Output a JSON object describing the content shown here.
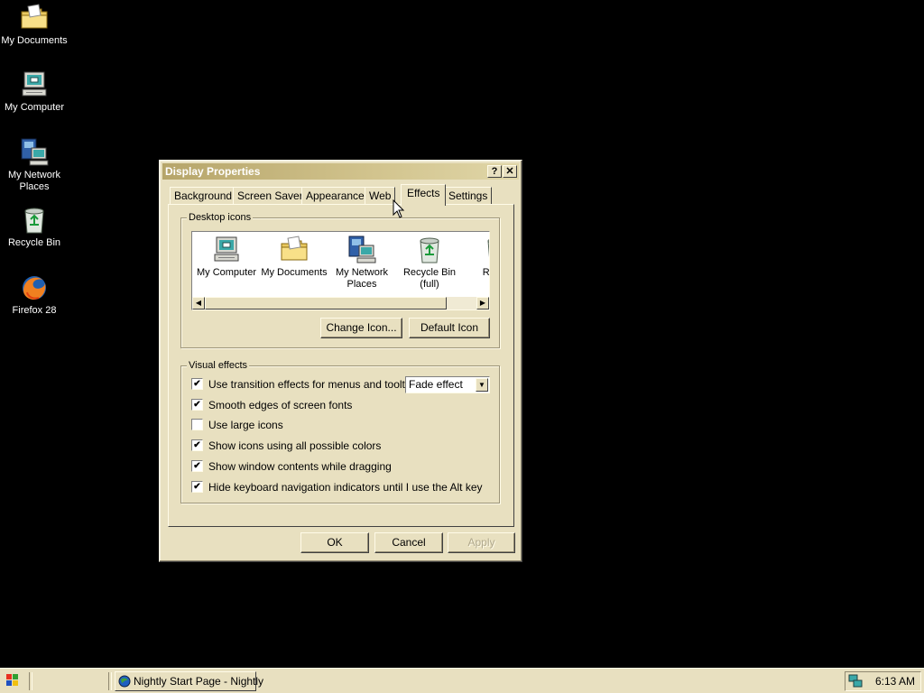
{
  "desktop": {
    "icons": [
      {
        "label": "My Documents",
        "icon": "folder-icon"
      },
      {
        "label": "My Computer",
        "icon": "computer-icon"
      },
      {
        "label": "My Network Places",
        "icon": "network-icon"
      },
      {
        "label": "Recycle Bin",
        "icon": "recycle-bin-icon"
      },
      {
        "label": "Firefox 28",
        "icon": "firefox-icon"
      }
    ]
  },
  "window": {
    "title": "Display Properties",
    "help_label": "?",
    "close_label": "✕",
    "tabs": [
      {
        "label": "Background",
        "active": false
      },
      {
        "label": "Screen Saver",
        "active": false
      },
      {
        "label": "Appearance",
        "active": false
      },
      {
        "label": "Web",
        "active": false
      },
      {
        "label": "Effects",
        "active": true
      },
      {
        "label": "Settings",
        "active": false
      }
    ],
    "desktop_icons": {
      "title": "Desktop icons",
      "items": [
        {
          "label": "My Computer",
          "icon": "computer-icon"
        },
        {
          "label": "My Documents",
          "icon": "folder-icon"
        },
        {
          "label": "My Network Places",
          "icon": "network-icon"
        },
        {
          "label": "Recycle Bin (full)",
          "icon": "recycle-bin-full-icon"
        },
        {
          "label": "Rec (e",
          "icon": "recycle-bin-empty-icon"
        }
      ],
      "change_icon_label": "Change Icon...",
      "default_icon_label": "Default Icon"
    },
    "visual_effects": {
      "title": "Visual effects",
      "options": [
        {
          "label": "Use transition effects for menus and tooltips",
          "checked": true
        },
        {
          "label": "Smooth edges of screen fonts",
          "checked": true
        },
        {
          "label": "Use large icons",
          "checked": false
        },
        {
          "label": "Show icons using all possible colors",
          "checked": true
        },
        {
          "label": "Show window contents while dragging",
          "checked": true
        },
        {
          "label": "Hide keyboard navigation indicators until I use the Alt key",
          "checked": true
        }
      ],
      "transition_select": "Fade effect"
    },
    "buttons": {
      "ok": "OK",
      "cancel": "Cancel",
      "apply": "Apply"
    }
  },
  "taskbar": {
    "task_label": "Nightly Start Page - Nightly",
    "clock": "6:13 AM"
  }
}
